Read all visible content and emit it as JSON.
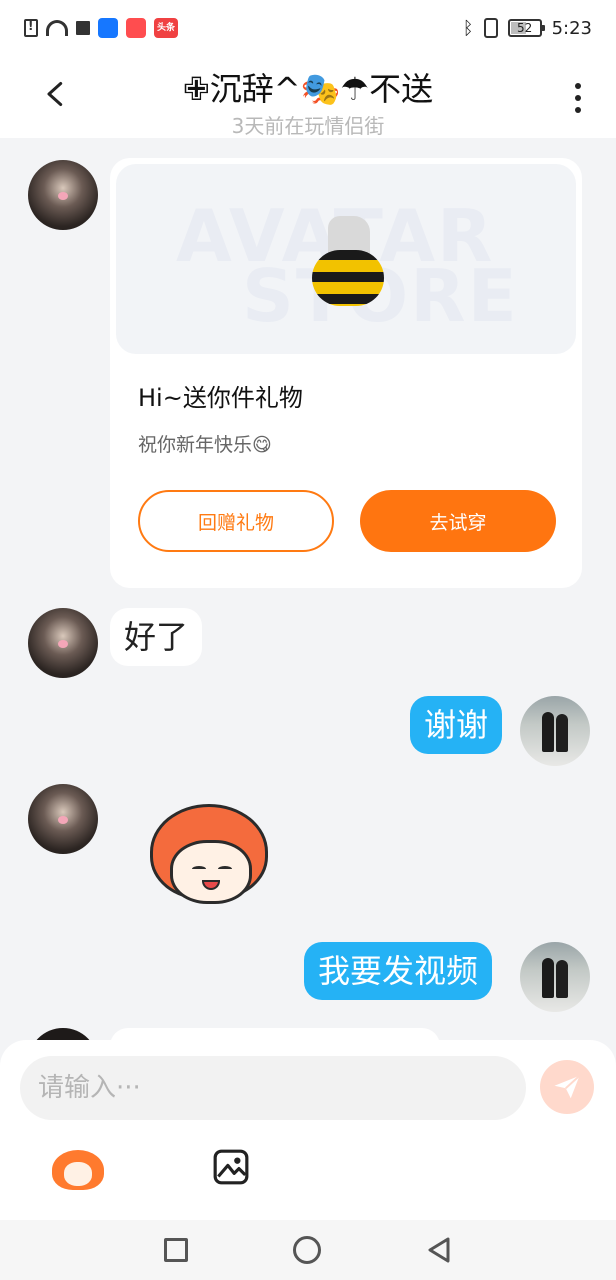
{
  "status_bar": {
    "time": "5:23",
    "battery": "52",
    "battery_level": 0.52,
    "notification_icons": [
      "sim-alert-icon",
      "wifi-icon",
      "square-icon",
      "shield-app-icon",
      "shopping-app-icon",
      "toutiao-app-icon"
    ],
    "toutiao_label": "头条"
  },
  "header": {
    "title": "✙沉辞^🎭☂不送",
    "subtitle": "3天前在玩情侣街"
  },
  "messages": {
    "gift_card": {
      "banner_text_1": "AVATAR",
      "banner_text_2": "STORE",
      "title": "Hi~送你件礼物",
      "description": "祝你新年快乐😋",
      "return_gift_label": "回赠礼物",
      "try_on_label": "去试穿"
    },
    "msg_1": "好了",
    "msg_2": "谢谢",
    "msg_3": "我要发视频"
  },
  "input": {
    "placeholder": "请输入···"
  },
  "colors": {
    "accent_orange": "#ff7510",
    "bubble_blue": "#25b2f5",
    "send_disabled": "#ffd9cc"
  }
}
